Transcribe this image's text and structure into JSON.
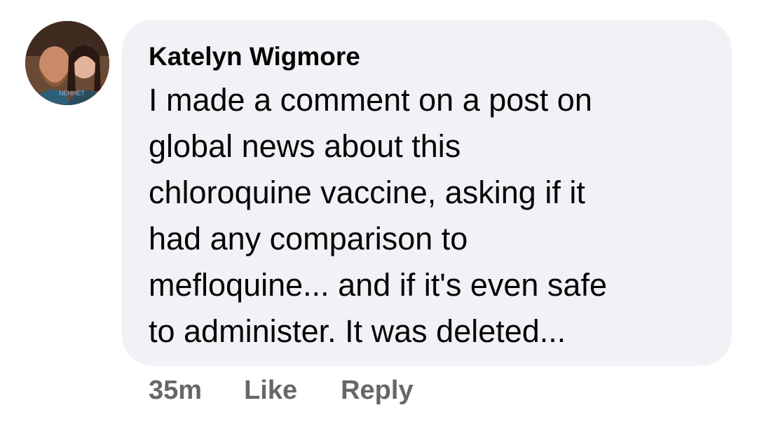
{
  "comment": {
    "author": "Katelyn Wigmore",
    "text_lines": [
      "I made a comment on a post on",
      "global news about this",
      "chloroquine vaccine, asking if it",
      "had any comparison to",
      "mefloquine... and if it's even safe",
      "to administer. It was deleted..."
    ]
  },
  "actions": {
    "timestamp": "35m",
    "like_label": "Like",
    "reply_label": "Reply"
  },
  "colors": {
    "bubble_bg": "#f0f2f5",
    "text": "#050505",
    "meta": "#65676b"
  }
}
